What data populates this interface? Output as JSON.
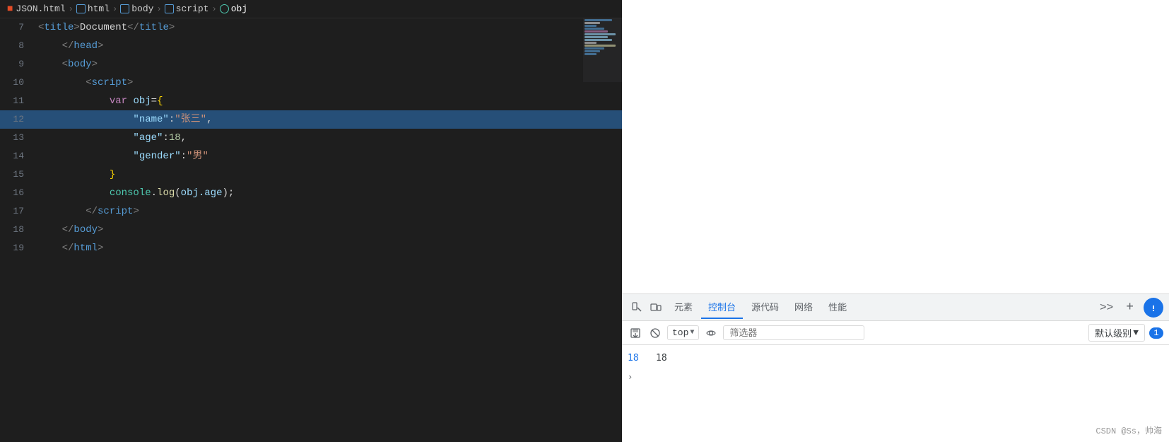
{
  "breadcrumb": {
    "html5": "5",
    "items": [
      "JSON.html",
      "html",
      "body",
      "script",
      "obj"
    ],
    "separators": [
      ">",
      ">",
      ">",
      ">"
    ]
  },
  "editor": {
    "lines": [
      {
        "num": "7",
        "tokens": [
          {
            "t": "indent",
            "text": "        "
          },
          {
            "t": "tag",
            "text": "<"
          },
          {
            "t": "tagname",
            "text": "title"
          },
          {
            "t": "tag",
            "text": ">"
          },
          {
            "t": "text",
            "text": "Document"
          },
          {
            "t": "tag",
            "text": "</"
          },
          {
            "t": "tagname",
            "text": "title"
          },
          {
            "t": "tag",
            "text": ">"
          }
        ]
      },
      {
        "num": "8",
        "tokens": [
          {
            "t": "indent",
            "text": "    "
          },
          {
            "t": "tag",
            "text": "</"
          },
          {
            "t": "tagname",
            "text": "head"
          },
          {
            "t": "tag",
            "text": ">"
          }
        ]
      },
      {
        "num": "9",
        "tokens": [
          {
            "t": "indent",
            "text": "    "
          },
          {
            "t": "tag",
            "text": "<"
          },
          {
            "t": "tagname",
            "text": "body"
          },
          {
            "t": "tag",
            "text": ">"
          }
        ]
      },
      {
        "num": "10",
        "tokens": [
          {
            "t": "indent",
            "text": "        "
          },
          {
            "t": "tag",
            "text": "<"
          },
          {
            "t": "tagname",
            "text": "script"
          },
          {
            "t": "tag",
            "text": ">"
          }
        ]
      },
      {
        "num": "11",
        "tokens": [
          {
            "t": "indent",
            "text": "            "
          },
          {
            "t": "keyword",
            "text": "var"
          },
          {
            "t": "text",
            "text": " obj="
          },
          {
            "t": "brace",
            "text": "{"
          }
        ]
      },
      {
        "num": "12",
        "tokens": [
          {
            "t": "indent2",
            "text": "                "
          },
          {
            "t": "key",
            "text": "\"name\""
          },
          {
            "t": "punct",
            "text": ":"
          },
          {
            "t": "valstr",
            "text": "\"张三\""
          },
          {
            "t": "punct",
            "text": ","
          }
        ],
        "selected": true
      },
      {
        "num": "13",
        "tokens": [
          {
            "t": "indent2",
            "text": "                "
          },
          {
            "t": "key",
            "text": "\"age\""
          },
          {
            "t": "punct",
            "text": ":"
          },
          {
            "t": "valnum",
            "text": "18"
          },
          {
            "t": "punct",
            "text": ","
          }
        ]
      },
      {
        "num": "14",
        "tokens": [
          {
            "t": "indent2",
            "text": "                "
          },
          {
            "t": "key",
            "text": "\"gender\""
          },
          {
            "t": "punct",
            "text": ":"
          },
          {
            "t": "valstr",
            "text": "\"男\""
          }
        ]
      },
      {
        "num": "15",
        "tokens": [
          {
            "t": "indent",
            "text": "            "
          },
          {
            "t": "brace",
            "text": "}"
          }
        ]
      },
      {
        "num": "16",
        "tokens": [
          {
            "t": "indent",
            "text": "            "
          },
          {
            "t": "obj",
            "text": "console"
          },
          {
            "t": "punct",
            "text": "."
          },
          {
            "t": "method",
            "text": "log"
          },
          {
            "t": "punct",
            "text": "("
          },
          {
            "t": "var",
            "text": "obj.age"
          },
          {
            "t": "punct",
            "text": ")"
          },
          {
            "t": "punct",
            "text": ";"
          }
        ]
      },
      {
        "num": "17",
        "tokens": [
          {
            "t": "indent",
            "text": "        "
          },
          {
            "t": "tag",
            "text": "</"
          },
          {
            "t": "tagname",
            "text": "script"
          },
          {
            "t": "tag",
            "text": ">"
          }
        ]
      },
      {
        "num": "18",
        "tokens": [
          {
            "t": "indent",
            "text": "    "
          },
          {
            "t": "tag",
            "text": "</"
          },
          {
            "t": "tagname",
            "text": "body"
          },
          {
            "t": "tag",
            "text": ">"
          }
        ]
      },
      {
        "num": "19",
        "tokens": [
          {
            "t": "indent",
            "text": "    "
          },
          {
            "t": "tag",
            "text": "</"
          },
          {
            "t": "tagname",
            "text": "html"
          },
          {
            "t": "tag",
            "text": ">"
          }
        ]
      }
    ]
  },
  "devtools": {
    "tabs": [
      {
        "label": "元素",
        "active": false
      },
      {
        "label": "控制台",
        "active": true
      },
      {
        "label": "源代码",
        "active": false
      },
      {
        "label": "网络",
        "active": false
      },
      {
        "label": "性能",
        "active": false
      }
    ],
    "toolbar": {
      "top_label": "top",
      "filter_placeholder": "筛选器",
      "level_label": "默认级别",
      "message_count": "1"
    },
    "console": {
      "output_line_num": "18",
      "output_value": "18",
      "arrow_label": "›",
      "watermark": "CSDN @Ss，帅海"
    }
  }
}
